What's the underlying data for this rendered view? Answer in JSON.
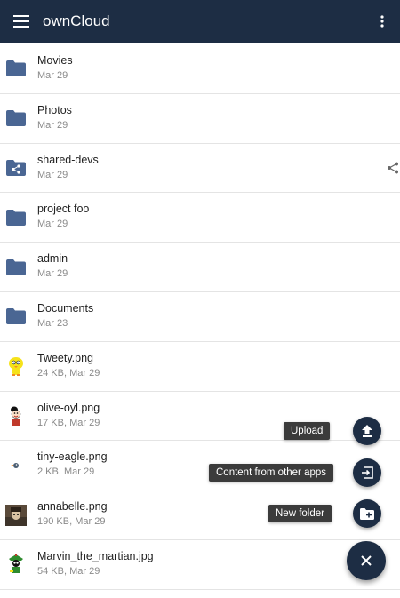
{
  "appbar": {
    "title": "ownCloud",
    "menu_icon": "hamburger-menu-icon",
    "overflow_icon": "more-vert-icon",
    "color": "#1d2d44"
  },
  "files": [
    {
      "name": "Movies",
      "meta": "Mar 29",
      "type": "folder"
    },
    {
      "name": "Photos",
      "meta": "Mar 29",
      "type": "folder"
    },
    {
      "name": "shared-devs",
      "meta": "Mar 29",
      "type": "shared-folder"
    },
    {
      "name": "project foo",
      "meta": "Mar 29",
      "type": "folder"
    },
    {
      "name": "admin",
      "meta": "Mar 29",
      "type": "folder"
    },
    {
      "name": "Documents",
      "meta": "Mar 23",
      "type": "folder"
    },
    {
      "name": "Tweety.png",
      "meta": "24 KB, Mar 29",
      "type": "image"
    },
    {
      "name": "olive-oyl.png",
      "meta": "17 KB, Mar 29",
      "type": "image"
    },
    {
      "name": "tiny-eagle.png",
      "meta": "2 KB, Mar 29",
      "type": "image"
    },
    {
      "name": "annabelle.png",
      "meta": "190 KB, Mar 29",
      "type": "image"
    },
    {
      "name": "Marvin_the_martian.jpg",
      "meta": "54 KB, Mar 29",
      "type": "image"
    }
  ],
  "fab": {
    "upload_label": "Upload",
    "content_label": "Content from other apps",
    "new_folder_label": "New folder",
    "close_icon": "close-icon"
  },
  "colors": {
    "folder": "#4a6693",
    "accent": "#1d2d44"
  }
}
